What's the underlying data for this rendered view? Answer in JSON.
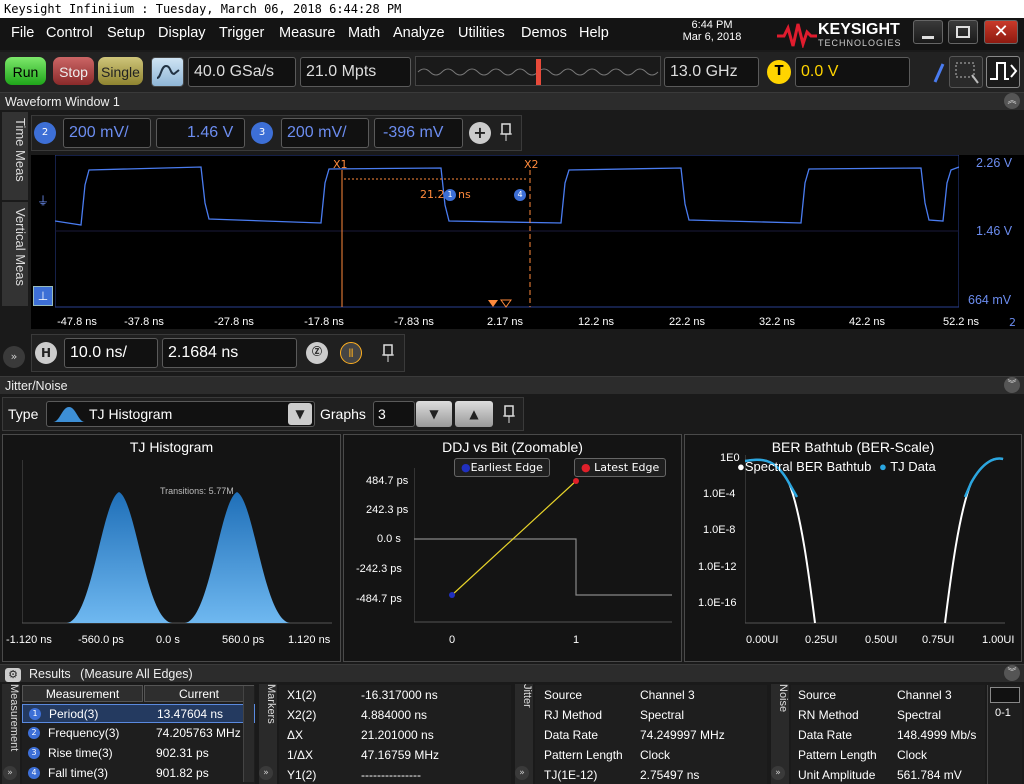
{
  "window": {
    "title": "Keysight Infiniium : Tuesday, March 06, 2018 6:44:28 PM"
  },
  "menu": [
    "File",
    "Control",
    "Setup",
    "Display",
    "Trigger",
    "Measure",
    "Math",
    "Analyze",
    "Utilities",
    "Demos",
    "Help"
  ],
  "clock": {
    "time": "6:44 PM",
    "date": "Mar 6, 2018"
  },
  "brand": {
    "name": "KEYSIGHT",
    "sub": "TECHNOLOGIES"
  },
  "toolbar": {
    "run": "Run",
    "stop": "Stop",
    "single": "Single",
    "sample_rate": "40.0 GSa/s",
    "memory_depth": "21.0 Mpts",
    "bandwidth": "13.0 GHz",
    "trigger_badge": "T",
    "trigger_level": "0.0 V"
  },
  "waveform": {
    "title": "Waveform Window 1",
    "side_tab_time": "Time Meas",
    "side_tab_vertical": "Vertical Meas",
    "ch2": {
      "badge": "2",
      "scale": "200 mV/",
      "offset": "1.46 V"
    },
    "ch3": {
      "badge": "3",
      "scale": "200 mV/",
      "offset": "-396 mV"
    },
    "y_top": "2.26 V",
    "y_mid": "1.46 V",
    "y_bottom": "664 mV",
    "x_ticks": [
      "-47.8 ns",
      "-37.8 ns",
      "-27.8 ns",
      "-17.8 ns",
      "-7.83 ns",
      "2.17 ns",
      "12.2 ns",
      "22.2 ns",
      "32.2 ns",
      "42.2 ns",
      "52.2 ns"
    ],
    "x_channel": "2",
    "marker_x1": "X1",
    "marker_x2": "X2",
    "delta_label": "21.2",
    "delta_unit": "ns",
    "marker_bubble_1": "1",
    "marker_bubble_4": "4",
    "h_badge": "H",
    "timebase": "10.0 ns/",
    "position": "2.1684 ns"
  },
  "jitter": {
    "title": "Jitter/Noise",
    "type_label": "Type",
    "type_value": "TJ Histogram",
    "graphs_label": "Graphs",
    "graphs_value": "3",
    "hist": {
      "title": "TJ Histogram",
      "annotation": "Transitions: 5.77M",
      "x_ticks": [
        "-1.120 ns",
        "-560.0 ps",
        "0.0 s",
        "560.0 ps",
        "1.120 ns"
      ]
    },
    "ddj": {
      "title": "DDJ vs Bit (Zoomable)",
      "legend_earliest": "Earliest Edge",
      "legend_latest": "Latest Edge",
      "y_ticks": [
        "484.7 ps",
        "242.3 ps",
        "0.0 s",
        "-242.3 ps",
        "-484.7 ps"
      ],
      "x_ticks": [
        "0",
        "1"
      ]
    },
    "ber": {
      "title": "BER Bathtub (BER-Scale)",
      "legend_spectral": "Spectral BER Bathtub",
      "legend_tj": "TJ Data",
      "y_ticks": [
        "1E0",
        "1.0E-4",
        "1.0E-8",
        "1.0E-12",
        "1.0E-16"
      ],
      "x_ticks": [
        "0.00UI",
        "0.25UI",
        "0.50UI",
        "0.75UI",
        "1.00UI"
      ]
    }
  },
  "results": {
    "title": "Results",
    "mode": "(Measure All Edges)",
    "side_tab": "Measurement",
    "col_measurement": "Measurement",
    "col_current": "Current",
    "rows": [
      {
        "badge": "1",
        "name": "Period(3)",
        "value": "13.47604 ns"
      },
      {
        "badge": "2",
        "name": "Frequency(3)",
        "value": "74.205763 MHz"
      },
      {
        "badge": "3",
        "name": "Rise time(3)",
        "value": "902.31 ps"
      },
      {
        "badge": "4",
        "name": "Fall time(3)",
        "value": "901.82 ps"
      }
    ],
    "markers_tab": "Markers",
    "markers": [
      {
        "k": "X1(2)",
        "v": "-16.317000 ns"
      },
      {
        "k": "X2(2)",
        "v": "4.884000 ns"
      },
      {
        "k": "ΔX",
        "v": "21.201000 ns"
      },
      {
        "k": "1/ΔX",
        "v": "47.16759 MHz"
      },
      {
        "k": "Y1(2)",
        "v": "---------------"
      }
    ],
    "jitter_tab": "Jitter",
    "jitter_rows": [
      {
        "k": "Source",
        "v": "Channel 3"
      },
      {
        "k": "RJ Method",
        "v": "Spectral"
      },
      {
        "k": "Data Rate",
        "v": "74.249997 MHz"
      },
      {
        "k": "Pattern Length",
        "v": "Clock"
      },
      {
        "k": "TJ(1E-12)",
        "v": "2.75497 ns"
      }
    ],
    "noise_tab": "Noise",
    "noise_rows": [
      {
        "k": "Source",
        "v": "Channel 3"
      },
      {
        "k": "RN Method",
        "v": "Spectral"
      },
      {
        "k": "Data Rate",
        "v": "148.4999 Mb/s"
      },
      {
        "k": "Pattern Length",
        "v": "Clock"
      },
      {
        "k": "Unit Amplitude",
        "v": "561.784 mV"
      }
    ],
    "page_indicator": "0-1"
  },
  "colors": {
    "accent": "#ffd400",
    "channel": "#6c8df0",
    "cursor": "#ff8a3c",
    "trace": "#4a7cf0"
  }
}
